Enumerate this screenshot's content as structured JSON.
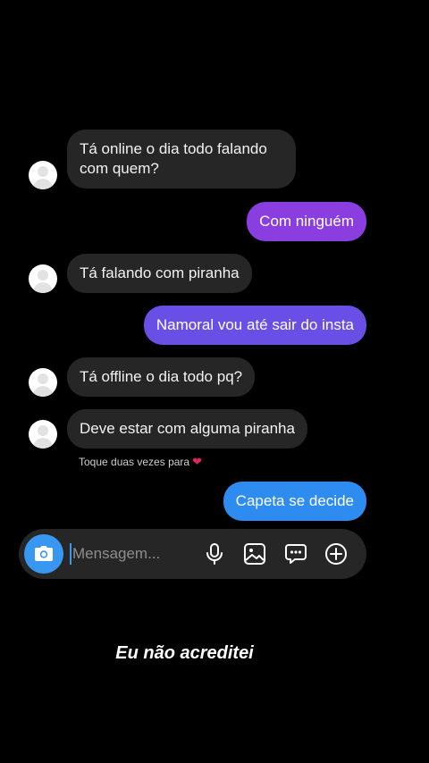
{
  "colors": {
    "background": "#000000",
    "incoming_bubble": "#262626",
    "outgoing_bubble_top": "#8a3ee0",
    "outgoing_bubble_mid": "#6a4fe6",
    "outgoing_bubble_bottom": "#2e8cf0",
    "camera_button": "#3897f0",
    "heart": "#e0245e"
  },
  "messages": [
    {
      "direction": "incoming",
      "lines": [
        "Tá online o dia todo falando",
        "com quem?"
      ]
    },
    {
      "direction": "outgoing",
      "text": "Com ninguém"
    },
    {
      "direction": "incoming",
      "text": "Tá falando com piranha"
    },
    {
      "direction": "outgoing",
      "text": "Namoral vou até sair do insta"
    },
    {
      "direction": "incoming",
      "text": "Tá offline o dia todo pq?"
    },
    {
      "direction": "incoming",
      "text": "Deve estar com alguma piranha"
    },
    {
      "direction": "outgoing",
      "text": "Capeta se decide"
    }
  ],
  "reaction_hint": {
    "text": "Toque duas vezes para",
    "icon": "heart-icon"
  },
  "composer": {
    "placeholder": "Mensagem...",
    "left_button_icon": "camera-icon",
    "tool_icons": [
      "microphone-icon",
      "gallery-icon",
      "sticker-icon",
      "plus-icon"
    ]
  },
  "caption": "Eu não acreditei"
}
